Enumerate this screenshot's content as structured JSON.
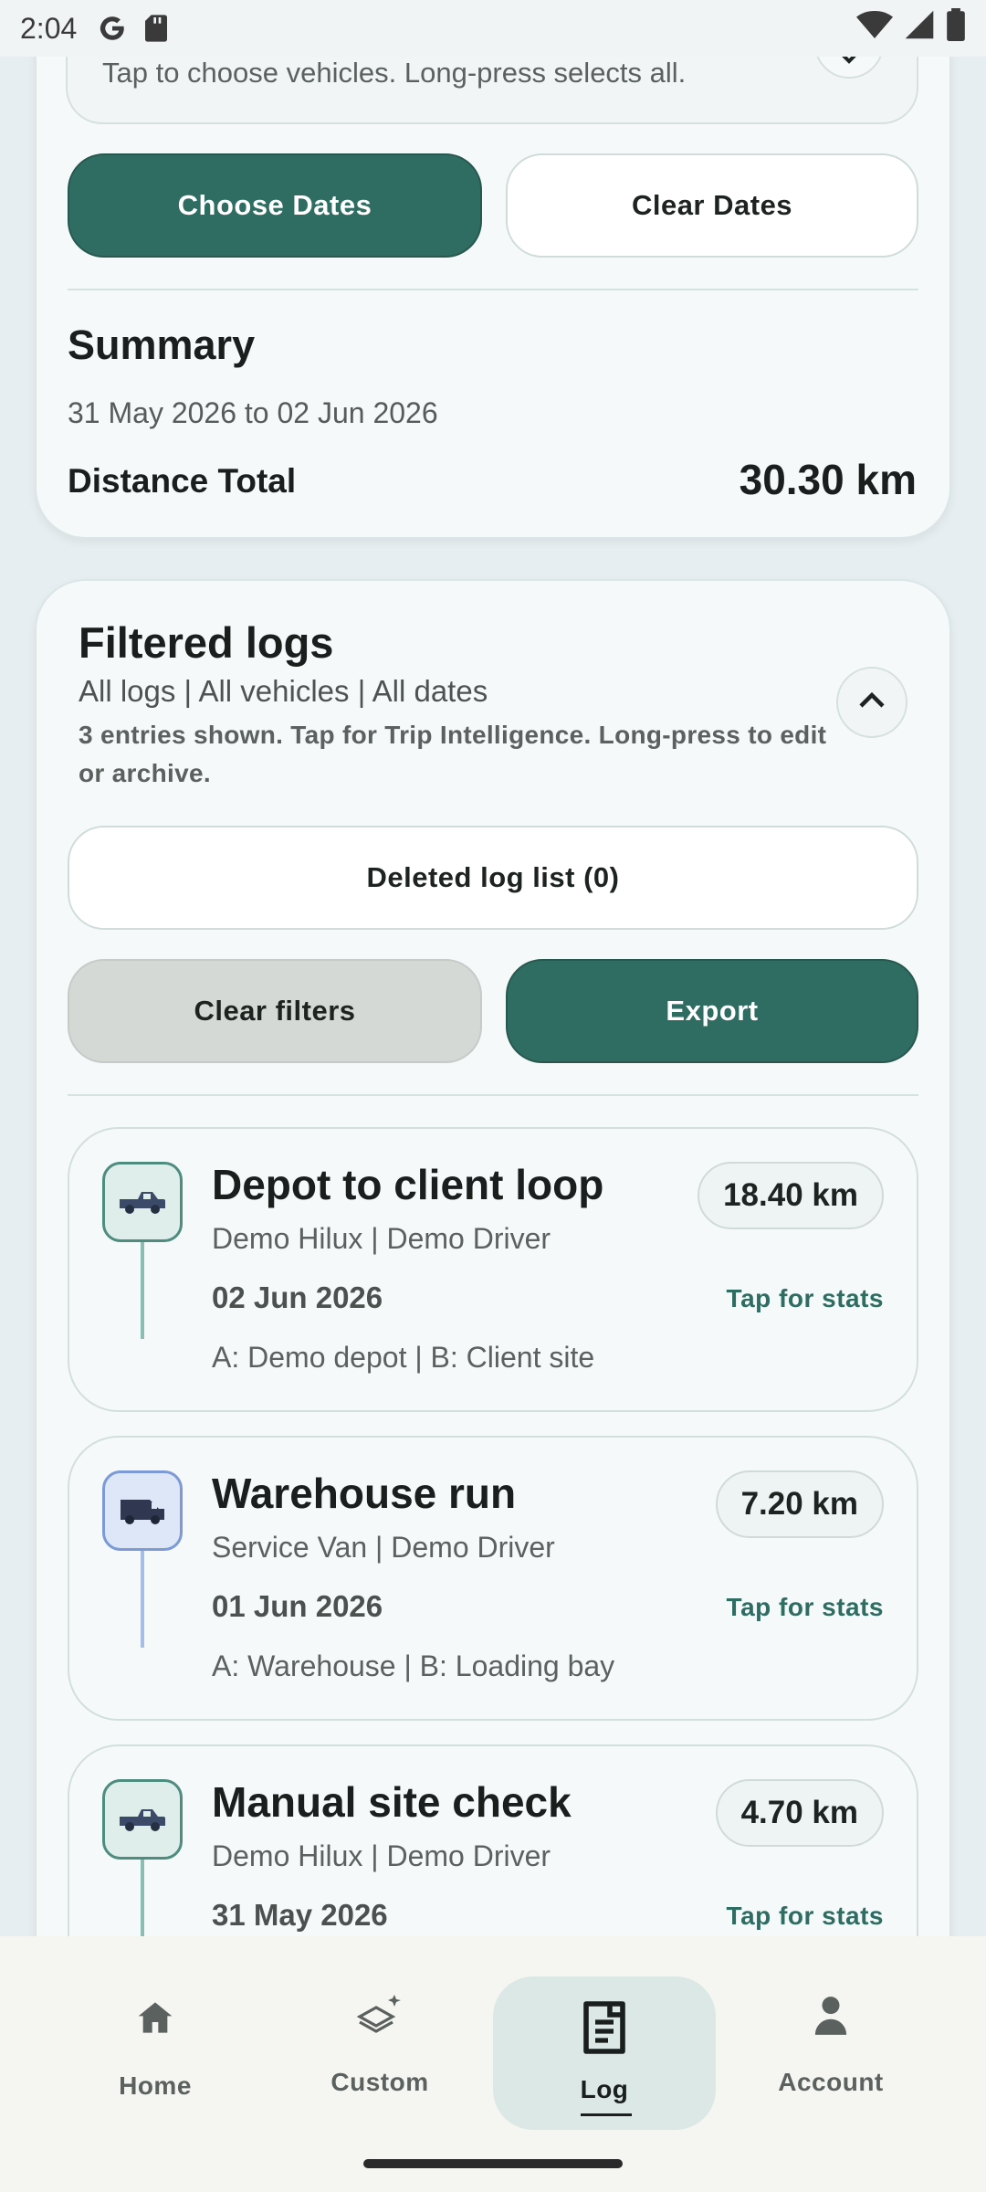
{
  "status_bar": {
    "time": "2:04",
    "icons": [
      "google-g-icon",
      "sd-card-icon",
      "wifi-icon",
      "signal-icon",
      "battery-icon"
    ]
  },
  "vehicle_selector": {
    "hint": "Tap to choose vehicles. Long-press selects all."
  },
  "date_buttons": {
    "choose": "Choose Dates",
    "clear": "Clear Dates"
  },
  "summary": {
    "title": "Summary",
    "range": "31 May 2026 to 02 Jun 2026",
    "distance_label": "Distance Total",
    "distance_value": "30.30 km"
  },
  "filtered_logs": {
    "title": "Filtered logs",
    "subtitle": "All logs | All vehicles | All dates",
    "hint": "3 entries shown. Tap for Trip Intelligence. Long-press to edit or archive.",
    "deleted_button": "Deleted log list (0)",
    "clear_filters_button": "Clear filters",
    "export_button": "Export"
  },
  "logs": [
    {
      "title": "Depot to client loop",
      "meta": "Demo Hilux | Demo Driver",
      "date": "02 Jun 2026",
      "stats": "Tap for stats",
      "route": "A: Demo depot  |  B: Client site",
      "km": "18.40 km",
      "vehicle_icon": "pickup-truck-icon",
      "accent": "#4e8c80"
    },
    {
      "title": "Warehouse run",
      "meta": "Service Van | Demo Driver",
      "date": "01 Jun 2026",
      "stats": "Tap for stats",
      "route": "A: Warehouse  |  B: Loading bay",
      "km": "7.20 km",
      "vehicle_icon": "van-icon",
      "accent": "#7b9ad6"
    },
    {
      "title": "Manual site check",
      "meta": "Demo Hilux | Demo Driver",
      "date": "31 May 2026",
      "stats": "Tap for stats",
      "route": "",
      "km": "4.70 km",
      "vehicle_icon": "pickup-truck-icon",
      "accent": "#4e8c80"
    }
  ],
  "bottom_nav": [
    {
      "label": "Home",
      "icon": "home-icon"
    },
    {
      "label": "Custom",
      "icon": "custom-sparkle-icon"
    },
    {
      "label": "Log",
      "icon": "log-document-icon",
      "active": true
    },
    {
      "label": "Account",
      "icon": "account-person-icon"
    }
  ],
  "colors": {
    "primary": "#2f6c62",
    "background": "#e6eef1",
    "card": "#f6f9fa"
  }
}
